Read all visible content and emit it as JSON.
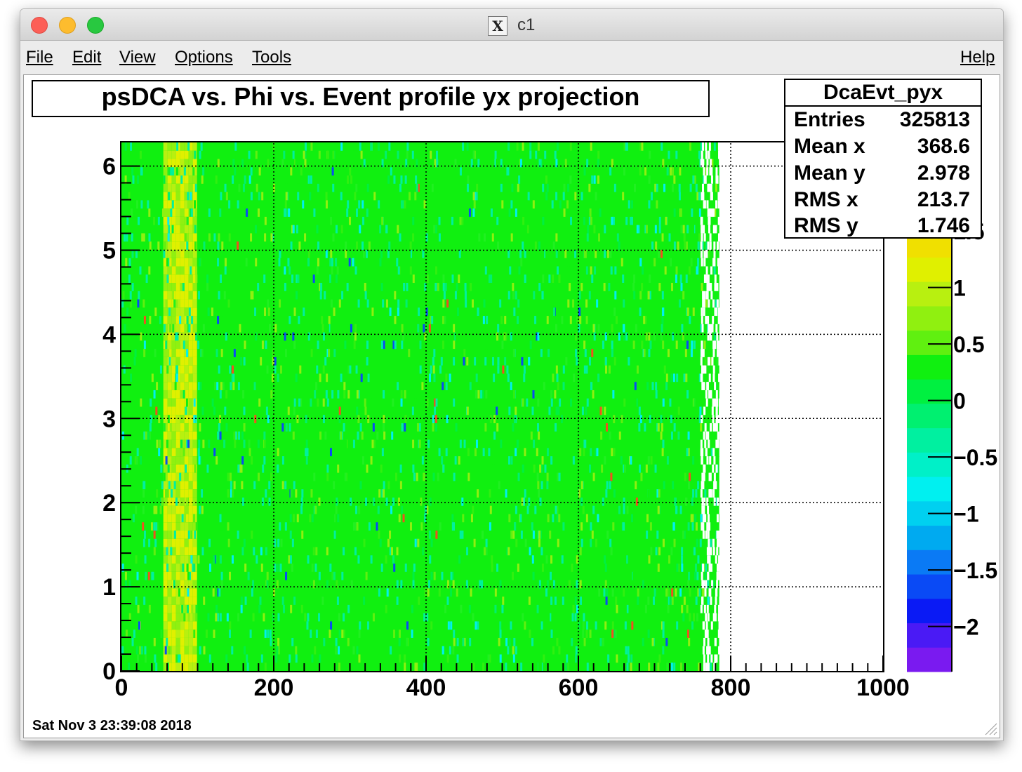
{
  "window": {
    "title": "c1"
  },
  "menu": {
    "file": "File",
    "edit": "Edit",
    "view": "View",
    "options": "Options",
    "tools": "Tools",
    "help": "Help"
  },
  "canvas": {
    "title": "psDCA vs. Phi vs. Event profile yx projection",
    "timestamp": "Sat Nov  3 23:39:08 2018"
  },
  "stats": {
    "name": "DcaEvt_pyx",
    "rows": [
      {
        "label": "Entries",
        "value": "325813"
      },
      {
        "label": "Mean x",
        "value": "368.6"
      },
      {
        "label": "Mean y",
        "value": "2.978"
      },
      {
        "label": "RMS x",
        "value": "213.7"
      },
      {
        "label": "RMS y",
        "value": "1.746"
      }
    ]
  },
  "chart_data": {
    "type": "heatmap",
    "x_ticks": [
      "0",
      "200",
      "400",
      "600",
      "800",
      "1000"
    ],
    "y_ticks": [
      "0",
      "1",
      "2",
      "3",
      "4",
      "5",
      "6"
    ],
    "xlim": [
      0,
      1000
    ],
    "ylim": [
      0,
      6.28
    ],
    "x_data_extent": [
      0,
      785
    ],
    "grid": true,
    "palette_labels": [
      "−2",
      "−1.5",
      "−1",
      "−0.5",
      "0",
      "0.5",
      "1",
      "1.5"
    ],
    "palette_range": [
      -2.4,
      1.7
    ],
    "palette_colors": [
      "#7a1af0",
      "#4a1af5",
      "#0a1af5",
      "#0a4af5",
      "#0a7af5",
      "#00aaf0",
      "#00d0f0",
      "#00f0f0",
      "#00f0c8",
      "#00f0a0",
      "#00f070",
      "#00f040",
      "#10f010",
      "#60f010",
      "#90f010",
      "#b8f010",
      "#e0f000",
      "#f0e000",
      "#f8a800"
    ]
  }
}
